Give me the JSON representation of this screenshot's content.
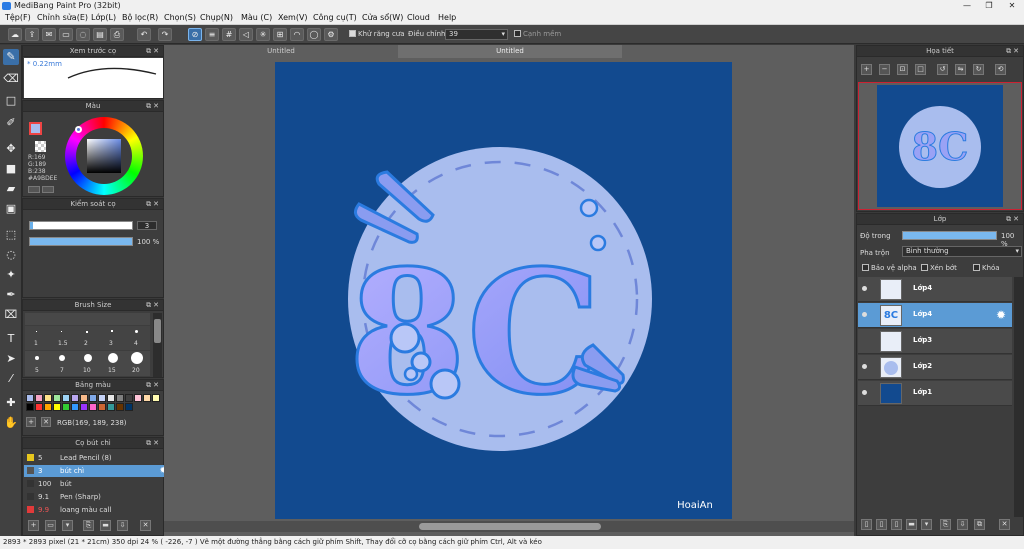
{
  "window": {
    "title": "MediBang Paint Pro (32bit)",
    "minimize": "—",
    "maximize": "❐",
    "close": "✕"
  },
  "menu": [
    "Tệp(F)",
    "Chỉnh sửa(E)",
    "Lớp(L)",
    "Bộ lọc(R)",
    "Chọn(S)",
    "Chụp(N)",
    "Màu (C)",
    "Xem(V)",
    "Công cụ(T)",
    "Cửa sổ(W)",
    "Cloud",
    "Help"
  ],
  "toolbar": {
    "antialias_label": "Khử răng cưa",
    "correction_label": "Điều chỉnh",
    "correction_value": "39",
    "edge_smooth_label": "Cạnh mềm"
  },
  "brush_preview": {
    "title": "Xem trước cọ",
    "size_label": "* 0.22mm"
  },
  "color_panel": {
    "title": "Màu",
    "r": "R:169",
    "g": "G:189",
    "b": "B:238",
    "hex": "#A9BDEE",
    "fg_color": "#a9bdee"
  },
  "brush_control": {
    "title": "Kiểm soát cọ",
    "size_value": "3",
    "opacity_value": "100 %",
    "opacity": 1.0
  },
  "brush_size": {
    "title": "Brush Size",
    "sizes": [
      "1",
      "1.5",
      "2",
      "3",
      "4",
      "5",
      "7",
      "10",
      "15",
      "20"
    ]
  },
  "palette": {
    "title": "Bảng màu",
    "rgb_label": "RGB(169, 189, 238)",
    "swatches": [
      "#a9bdee",
      "#f4a3c4",
      "#ffe28a",
      "#9ee59b",
      "#9dd3f5",
      "#b9a7f0",
      "#f7b98a",
      "#7fa8e8",
      "#c5d2f7",
      "#e6e6e6",
      "#7f7f7f",
      "#3f3f3f",
      "#ffc4d8",
      "#ffd9a8",
      "#fffbb0",
      "#000000",
      "#ff3333",
      "#ffa500",
      "#ffff00",
      "#33cc33",
      "#3399ff",
      "#9933ff",
      "#ff66cc",
      "#cc6633",
      "#339999",
      "#663300",
      "#003366"
    ]
  },
  "brush_list": {
    "title": "Cọ bút chì",
    "items": [
      {
        "size": "5",
        "name": "Lead Pencil (8)",
        "color": "#e8c71d"
      },
      {
        "size": "3",
        "name": "bút chì",
        "color": "#555555"
      },
      {
        "size": "100",
        "name": "bút",
        "color": "#333333"
      },
      {
        "size": "9.1",
        "name": "Pen (Sharp)",
        "color": "#333333"
      },
      {
        "size": "9.9",
        "name": "loang màu call",
        "color": "#e23a3a"
      }
    ]
  },
  "tabs": [
    "Untitled",
    "Untitled"
  ],
  "artwork": {
    "text": "8C",
    "signature": "HoaiAn"
  },
  "navigator": {
    "title": "Họa tiết"
  },
  "layers": {
    "title": "Lớp",
    "opacity_label": "Độ trong",
    "opacity_value": "100 %",
    "opacity": 1.0,
    "blend_label": "Pha trộn",
    "blend_value": "Bình thường",
    "protect_alpha": "Bảo vệ alpha",
    "clipping": "Xén bớt",
    "lock": "Khóa",
    "items": [
      {
        "name": "Lớp4",
        "selected": false
      },
      {
        "name": "Lớp4",
        "selected": true
      },
      {
        "name": "Lớp3",
        "selected": false
      },
      {
        "name": "Lớp2",
        "selected": false
      },
      {
        "name": "Lớp1",
        "selected": false
      }
    ]
  },
  "status": "2893 * 2893 pixel  (21 * 21cm)  350 dpi  24 %  ( -226, -7 )  Vẽ một đường thẳng bằng cách giữ phím Shift, Thay đổi cỡ cọ bằng cách giữ phím Ctrl, Alt và kéo"
}
